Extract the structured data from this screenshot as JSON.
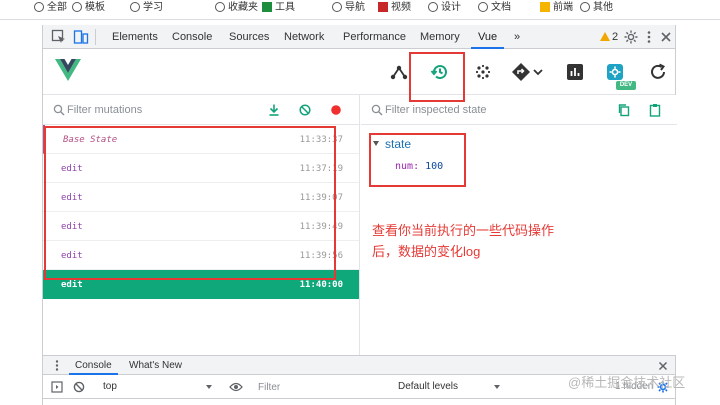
{
  "bookmarks": [
    "全部",
    "模板",
    "学习",
    "收藏夹",
    "工具",
    "导航",
    "视频",
    "设计",
    "文档",
    "前端",
    "其他"
  ],
  "devtools_tabs": [
    "Elements",
    "Console",
    "Sources",
    "Network",
    "Performance",
    "Memory",
    "Vue"
  ],
  "active_tab": "Vue",
  "more_tabs": "»",
  "warning_count": "2",
  "toolbar_icons": [
    "components-tree-icon",
    "timeline-history-icon",
    "events-icon",
    "routing-icon",
    "performance-chart-icon",
    "settings-icon",
    "refresh-icon"
  ],
  "dev_badge": "DEV",
  "mutations": {
    "filter_placeholder": "Filter mutations",
    "items": [
      {
        "name": "Base State",
        "time": "11:33:37"
      },
      {
        "name": "edit",
        "time": "11:37:19"
      },
      {
        "name": "edit",
        "time": "11:39:07"
      },
      {
        "name": "edit",
        "time": "11:39:49"
      },
      {
        "name": "edit",
        "time": "11:39:56"
      },
      {
        "name": "edit",
        "time": "11:40:00"
      }
    ]
  },
  "inspector": {
    "filter_placeholder": "Filter inspected state",
    "state_label": "state",
    "prop_name": "num",
    "prop_value": "100"
  },
  "annotation": {
    "line1": "查看你当前执行的一些代码操作",
    "line2": "后，数据的变化log"
  },
  "drawer": {
    "tabs": [
      "Console",
      "What's New"
    ],
    "context": "top",
    "filter_placeholder": "Filter",
    "levels": "Default levels",
    "hidden": "1 hidden"
  },
  "watermark": "@稀土掘金技术社区",
  "colors": {
    "vue_green": "#42b983",
    "selected_row": "#0fa87a",
    "annotation_red": "#e53935",
    "history_icon": "#12a37a"
  }
}
